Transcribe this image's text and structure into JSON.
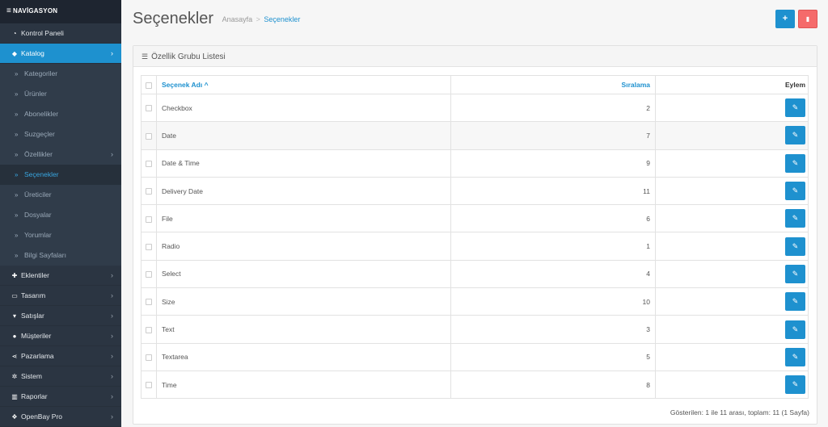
{
  "sidebar": {
    "heading": "NAVİGASYON",
    "items": [
      {
        "label": "Kontrol Paneli",
        "icon": "dashboard-icon"
      },
      {
        "label": "Katalog",
        "icon": "tag-icon"
      },
      {
        "label": "Eklentiler",
        "icon": "puzzle-icon"
      },
      {
        "label": "Tasarım",
        "icon": "monitor-icon"
      },
      {
        "label": "Satışlar",
        "icon": "cart-icon"
      },
      {
        "label": "Müşteriler",
        "icon": "user-icon"
      },
      {
        "label": "Pazarlama",
        "icon": "share-icon"
      },
      {
        "label": "Sistem",
        "icon": "gear-icon"
      },
      {
        "label": "Raporlar",
        "icon": "bar-chart-icon"
      },
      {
        "label": "OpenBay Pro",
        "icon": "cubes-icon"
      }
    ],
    "catalog_sub": [
      "Kategoriler",
      "Ürünler",
      "Abonelikler",
      "Suzgeçler",
      "Özellikler",
      "Seçenekler",
      "Üreticiler",
      "Dosyalar",
      "Yorumlar",
      "Bilgi Sayfaları"
    ]
  },
  "header": {
    "title": "Seçenekler",
    "breadcrumb_home": "Anasayfa",
    "breadcrumb_sep": ">",
    "breadcrumb_current": "Seçenekler"
  },
  "panel": {
    "title": "Özellik Grubu Listesi"
  },
  "table": {
    "col_name": "Seçenek Adı ^",
    "col_sort": "Sıralama",
    "col_action": "Eylem",
    "rows": [
      {
        "name": "Checkbox",
        "sort": "2"
      },
      {
        "name": "Date",
        "sort": "7"
      },
      {
        "name": "Date & Time",
        "sort": "9"
      },
      {
        "name": "Delivery Date",
        "sort": "11"
      },
      {
        "name": "File",
        "sort": "6"
      },
      {
        "name": "Radio",
        "sort": "1"
      },
      {
        "name": "Select",
        "sort": "4"
      },
      {
        "name": "Size",
        "sort": "10"
      },
      {
        "name": "Text",
        "sort": "3"
      },
      {
        "name": "Textarea",
        "sort": "5"
      },
      {
        "name": "Time",
        "sort": "8"
      }
    ]
  },
  "footer": {
    "info": "Gösterilen: 1 ile 11 arası, toplam: 11 (1 Sayfa)"
  },
  "colors": {
    "sidebar_bg": "#2b3542",
    "accent": "#1e91cf",
    "danger": "#f56b6b"
  }
}
